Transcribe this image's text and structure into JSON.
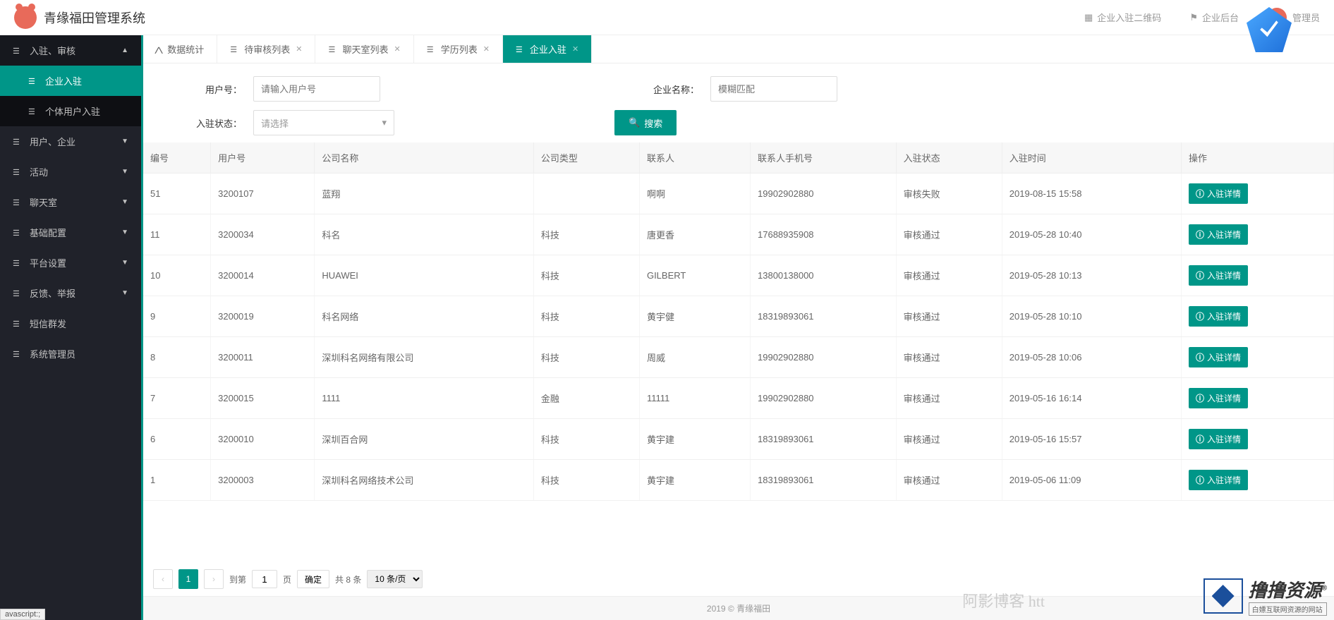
{
  "header": {
    "title": "青缘福田管理系统",
    "links": {
      "qrcode": "企业入驻二维码",
      "backend": "企业后台",
      "admin": "管理员"
    }
  },
  "sidebar": {
    "items": [
      {
        "label": "入驻、审核",
        "expanded": true,
        "children": [
          {
            "label": "企业入驻",
            "active": true
          },
          {
            "label": "个体用户入驻",
            "active": false
          }
        ]
      },
      {
        "label": "用户、企业"
      },
      {
        "label": "活动"
      },
      {
        "label": "聊天室"
      },
      {
        "label": "基础配置"
      },
      {
        "label": "平台设置"
      },
      {
        "label": "反馈、举报"
      },
      {
        "label": "短信群发"
      },
      {
        "label": "系统管理员"
      }
    ]
  },
  "tabs": [
    {
      "label": "数据统计",
      "closable": false
    },
    {
      "label": "待审核列表",
      "closable": true
    },
    {
      "label": "聊天室列表",
      "closable": true
    },
    {
      "label": "学历列表",
      "closable": true
    },
    {
      "label": "企业入驻",
      "closable": true,
      "active": true
    }
  ],
  "search": {
    "user_label": "用户号：",
    "user_placeholder": "请输入用户号",
    "company_label": "企业名称：",
    "company_placeholder": "模糊匹配",
    "status_label": "入驻状态：",
    "status_placeholder": "请选择",
    "search_btn": "搜索"
  },
  "table": {
    "columns": [
      "编号",
      "用户号",
      "公司名称",
      "公司类型",
      "联系人",
      "联系人手机号",
      "入驻状态",
      "入驻时间",
      "操作"
    ],
    "action_label": "入驻详情",
    "rows": [
      {
        "id": "51",
        "user": "3200107",
        "company": "蓝翔",
        "type": "",
        "contact": "啊啊",
        "phone": "19902902880",
        "status": "审核失败",
        "time": "2019-08-15 15:58"
      },
      {
        "id": "11",
        "user": "3200034",
        "company": "科名",
        "type": "科技",
        "contact": "唐更香",
        "phone": "17688935908",
        "status": "审核通过",
        "time": "2019-05-28 10:40"
      },
      {
        "id": "10",
        "user": "3200014",
        "company": "HUAWEI",
        "type": "科技",
        "contact": "GILBERT",
        "phone": "13800138000",
        "status": "审核通过",
        "time": "2019-05-28 10:13"
      },
      {
        "id": "9",
        "user": "3200019",
        "company": "科名网络",
        "type": "科技",
        "contact": "黄宇健",
        "phone": "18319893061",
        "status": "审核通过",
        "time": "2019-05-28 10:10"
      },
      {
        "id": "8",
        "user": "3200011",
        "company": "深圳科名网络有限公司",
        "type": "科技",
        "contact": "周威",
        "phone": "19902902880",
        "status": "审核通过",
        "time": "2019-05-28 10:06"
      },
      {
        "id": "7",
        "user": "3200015",
        "company": "1111",
        "type": "金融",
        "contact": "11111",
        "phone": "19902902880",
        "status": "审核通过",
        "time": "2019-05-16 16:14"
      },
      {
        "id": "6",
        "user": "3200010",
        "company": "深圳百合网",
        "type": "科技",
        "contact": "黄宇建",
        "phone": "18319893061",
        "status": "审核通过",
        "time": "2019-05-16 15:57"
      },
      {
        "id": "1",
        "user": "3200003",
        "company": "深圳科名网络技术公司",
        "type": "科技",
        "contact": "黄宇建",
        "phone": "18319893061",
        "status": "审核通过",
        "time": "2019-05-06 11:09"
      }
    ]
  },
  "pagination": {
    "current": "1",
    "goto_label": "到第",
    "page_unit": "页",
    "page_input": "1",
    "confirm": "确定",
    "total": "共 8 条",
    "per_page": "10 条/页"
  },
  "footer": {
    "text": "2019 © 青缘福田"
  },
  "statusbar": {
    "text": "avascript:;"
  },
  "watermark": {
    "blog": "阿影博客 htt",
    "brand_main": "撸撸资源",
    "brand_r": "®",
    "brand_sub": "白嫖互联网资源的网站"
  }
}
